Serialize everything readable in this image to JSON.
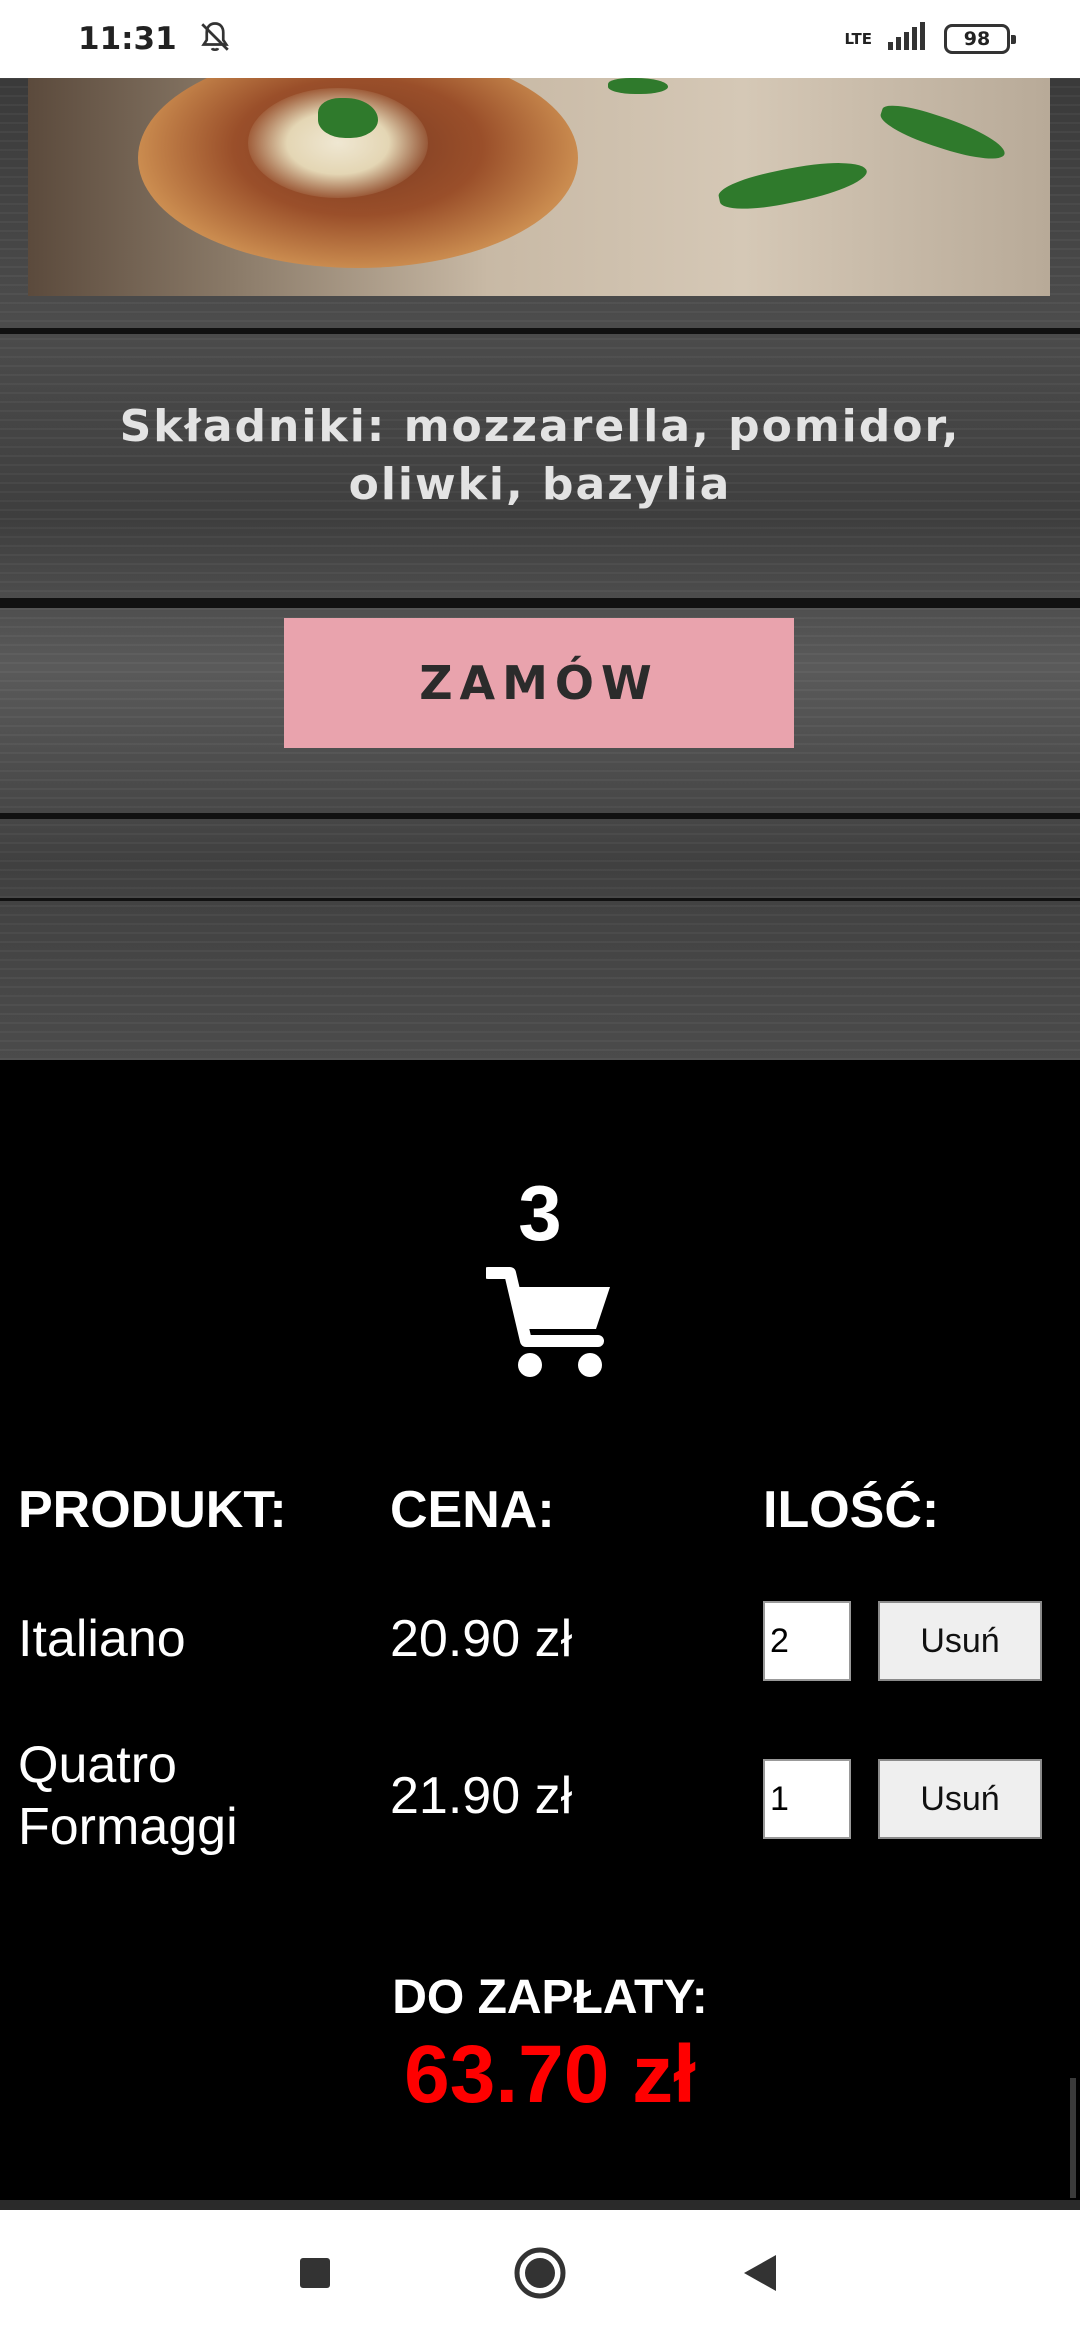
{
  "status_bar": {
    "time": "11:31",
    "network": "LTE",
    "battery": "98"
  },
  "product": {
    "ingredients": "Składniki: mozzarella, pomidor, oliwki, bazylia",
    "order_button": "ZAMÓW"
  },
  "cart": {
    "count": "3",
    "headers": {
      "product": "PRODUKT:",
      "price": "CENA:",
      "quantity": "ILOŚĆ:"
    },
    "items": [
      {
        "name": "Italiano",
        "price": "20.90 zł",
        "quantity": "2",
        "remove_label": "Usuń"
      },
      {
        "name": "Quatro Formaggi",
        "price": "21.90 zł",
        "quantity": "1",
        "remove_label": "Usuń"
      }
    ],
    "total_label": "DO ZAPŁATY:",
    "total_value": "63.70 zł"
  },
  "colors": {
    "order_button_bg": "#e9a3ad",
    "total_value": "#ff0000",
    "cart_bg": "#000000"
  },
  "icons": [
    "bell-off-icon",
    "signal-icon",
    "battery-icon",
    "cart-icon",
    "nav-recents-icon",
    "nav-home-icon",
    "nav-back-icon"
  ]
}
